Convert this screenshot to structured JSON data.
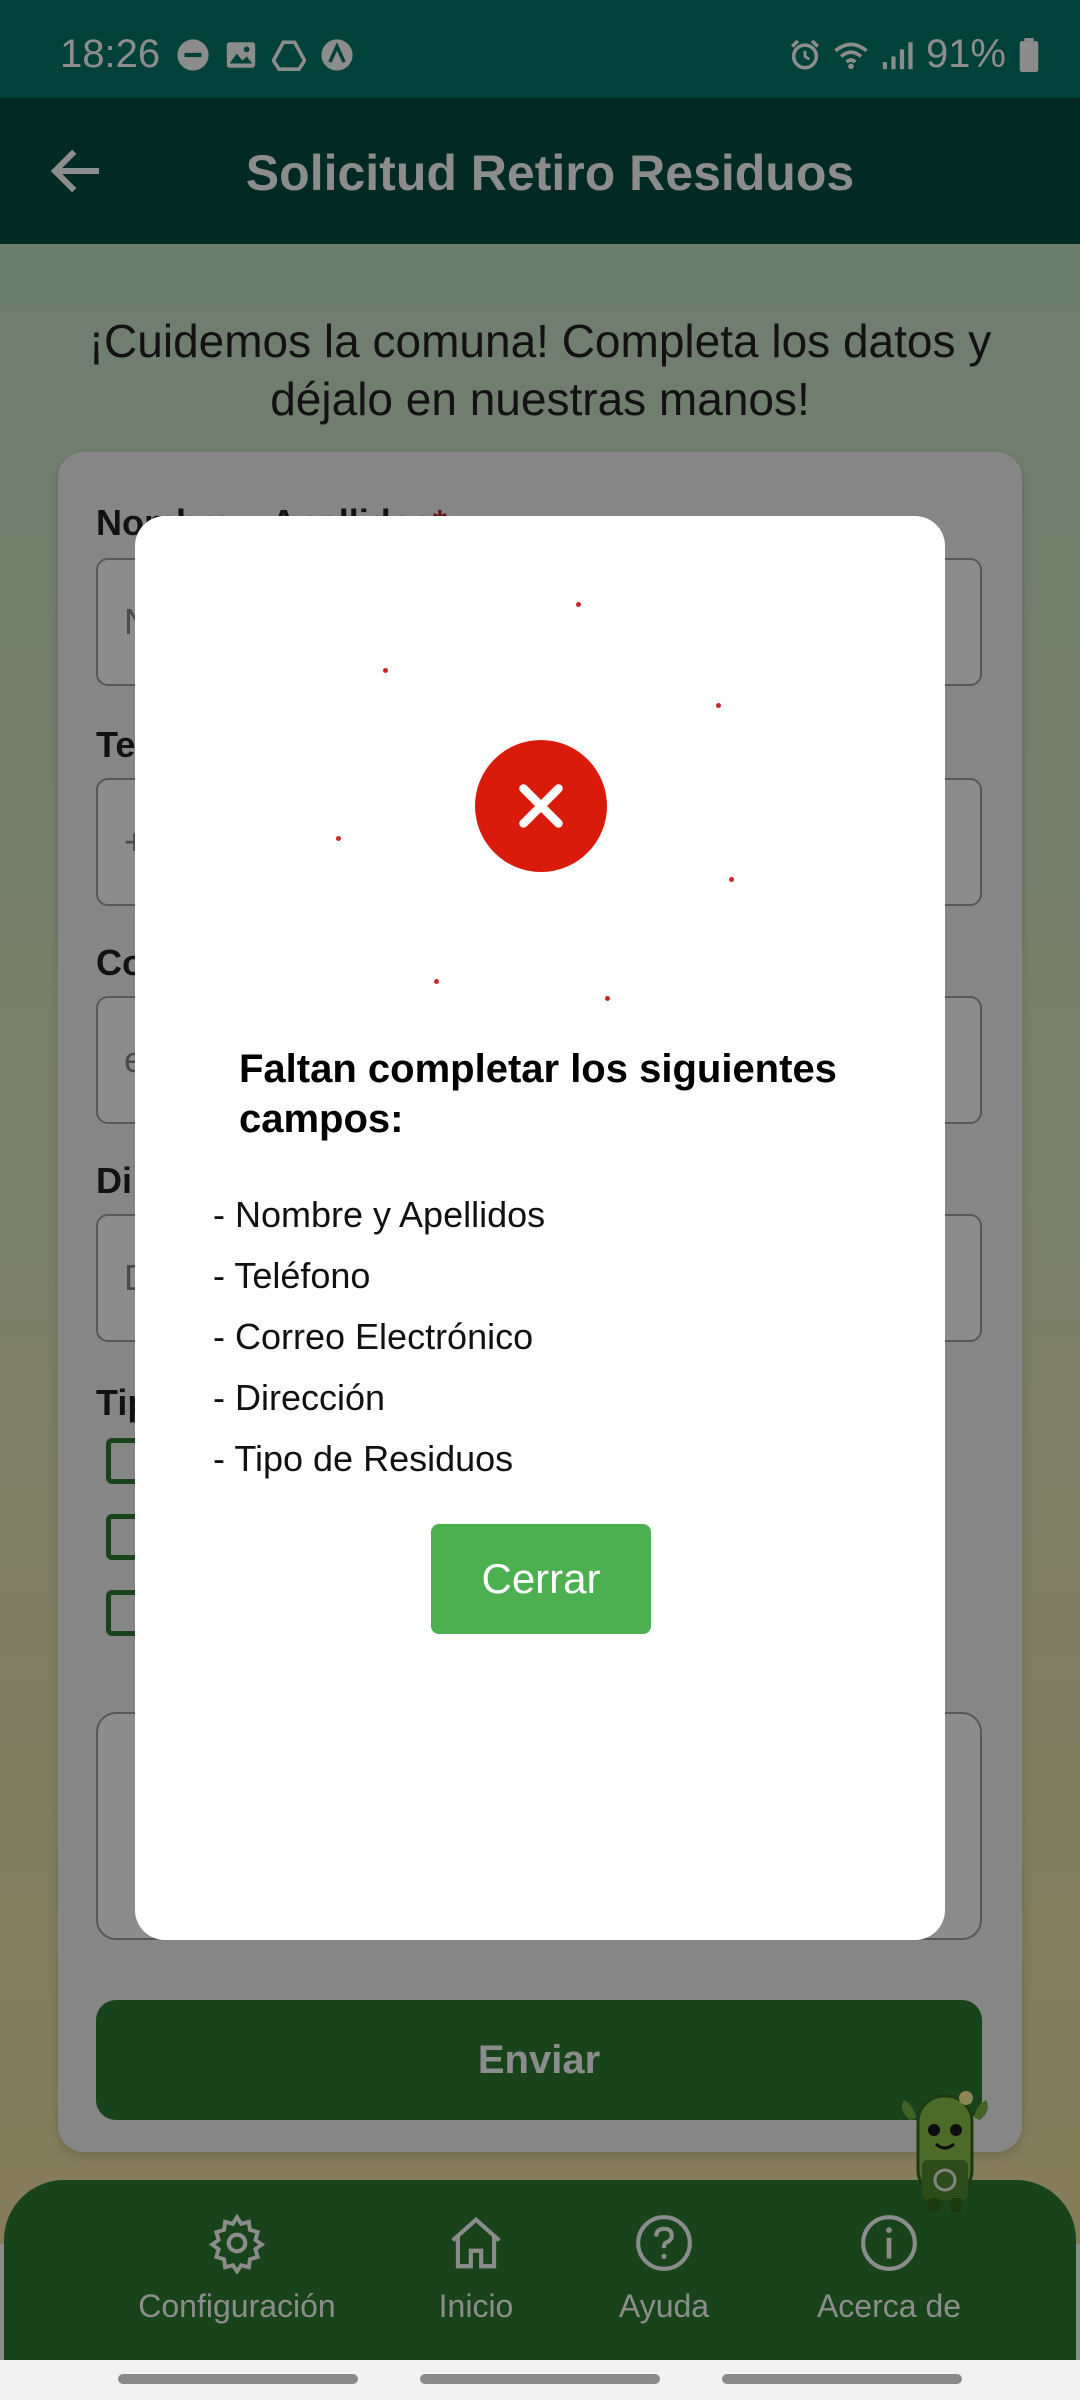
{
  "status_bar": {
    "time": "18:26",
    "battery": "91%",
    "icons_left": [
      "do-not-disturb-icon",
      "image-icon",
      "drive-icon",
      "app-icon"
    ],
    "icons_right": [
      "alarm-icon",
      "wifi-icon",
      "signal-icon",
      "battery-icon"
    ]
  },
  "app_bar": {
    "title": "Solicitud Retiro Residuos",
    "back_icon": "arrow-left-icon"
  },
  "form": {
    "intro": "¡Cuidemos la comuna! Completa los datos y déjalo en nuestras manos!",
    "name_label": "Nombre y Apellidos",
    "required_mark": "*",
    "name_placeholder": "N",
    "phone_label": "Te",
    "phone_placeholder": "+",
    "email_label": "Co",
    "email_placeholder": "e",
    "address_label": "Di",
    "address_placeholder": "D",
    "waste_type_label": "Tip",
    "submit_label": "Enviar"
  },
  "modal": {
    "icon": "error-x-icon",
    "title": "Faltan completar los siguientes campos:",
    "missing_fields": [
      "- Nombre y Apellidos",
      "- Teléfono",
      "- Correo Electrónico",
      "- Dirección",
      "- Tipo de Residuos"
    ],
    "close_label": "Cerrar"
  },
  "bottom_nav": {
    "items": [
      {
        "label": "Configuración",
        "icon": "gear-icon"
      },
      {
        "label": "Inicio",
        "icon": "home-icon"
      },
      {
        "label": "Ayuda",
        "icon": "help-icon"
      },
      {
        "label": "Acerca de",
        "icon": "info-icon"
      }
    ]
  },
  "colors": {
    "status_bar": "#00796b",
    "app_bar": "#004d40",
    "primary_green": "#2e7d32",
    "close_button": "#4caf50",
    "error_red": "#d81b0b"
  }
}
